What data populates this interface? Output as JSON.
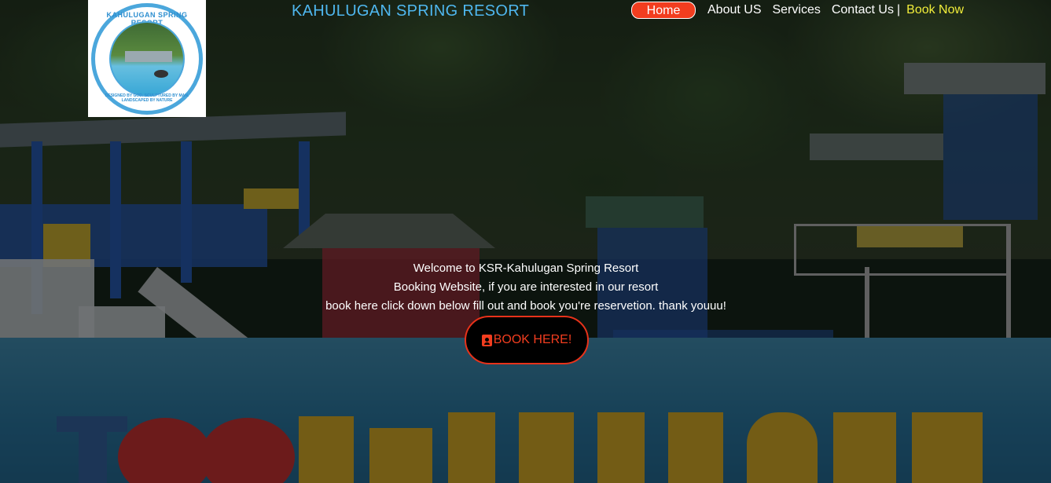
{
  "logo": {
    "alt": "Kahulugan Spring Resort logo",
    "top_text": "KAHULUGAN SPRING RESORT",
    "bottom_text": "DESIGNED BY GOD. SCULPTURED BY MAN. LANDSCAPED BY NATURE"
  },
  "header": {
    "title": "KAHULUGAN SPRING RESORT"
  },
  "nav": {
    "home": "Home",
    "about": "About US",
    "services": "Services",
    "contact": "Contact Us",
    "separator": "|",
    "book_now": "Book Now"
  },
  "hero": {
    "line1": "Welcome to KSR-Kahulugan Spring Resort",
    "line2": "Booking Website, if you are interested in our resort",
    "line3": "book here click down below fill out and book you're reservetion. thank youuu!",
    "button_label": "BOOK HERE!"
  },
  "colors": {
    "accent": "#f23d1f",
    "title_blue": "#4fb7ef",
    "book_now_yellow": "#f2ee3a"
  },
  "icons": {
    "book_button": "address-book-icon"
  }
}
